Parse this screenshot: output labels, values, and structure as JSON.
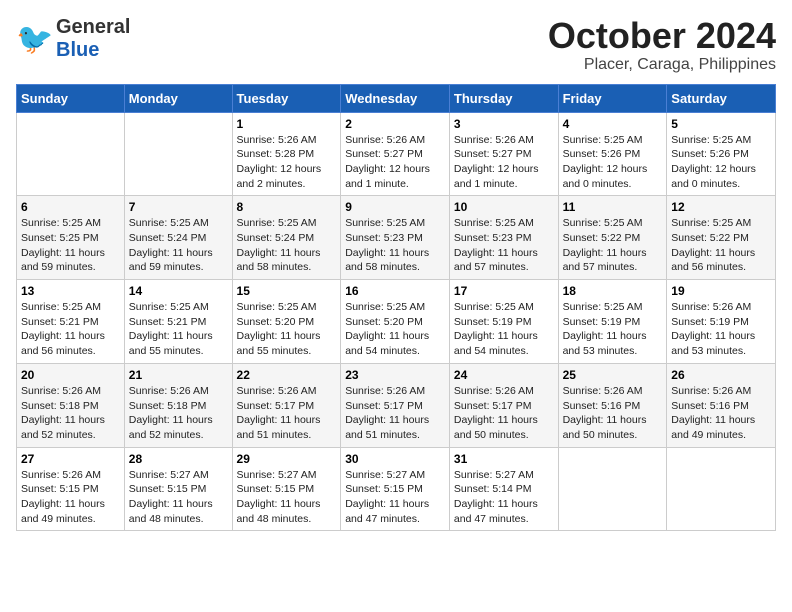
{
  "header": {
    "logo_line1": "General",
    "logo_line2": "Blue",
    "title": "October 2024",
    "subtitle": "Placer, Caraga, Philippines"
  },
  "calendar": {
    "days_of_week": [
      "Sunday",
      "Monday",
      "Tuesday",
      "Wednesday",
      "Thursday",
      "Friday",
      "Saturday"
    ],
    "weeks": [
      [
        {
          "day": "",
          "info": ""
        },
        {
          "day": "",
          "info": ""
        },
        {
          "day": "1",
          "info": "Sunrise: 5:26 AM\nSunset: 5:28 PM\nDaylight: 12 hours\nand 2 minutes."
        },
        {
          "day": "2",
          "info": "Sunrise: 5:26 AM\nSunset: 5:27 PM\nDaylight: 12 hours\nand 1 minute."
        },
        {
          "day": "3",
          "info": "Sunrise: 5:26 AM\nSunset: 5:27 PM\nDaylight: 12 hours\nand 1 minute."
        },
        {
          "day": "4",
          "info": "Sunrise: 5:25 AM\nSunset: 5:26 PM\nDaylight: 12 hours\nand 0 minutes."
        },
        {
          "day": "5",
          "info": "Sunrise: 5:25 AM\nSunset: 5:26 PM\nDaylight: 12 hours\nand 0 minutes."
        }
      ],
      [
        {
          "day": "6",
          "info": "Sunrise: 5:25 AM\nSunset: 5:25 PM\nDaylight: 11 hours\nand 59 minutes."
        },
        {
          "day": "7",
          "info": "Sunrise: 5:25 AM\nSunset: 5:24 PM\nDaylight: 11 hours\nand 59 minutes."
        },
        {
          "day": "8",
          "info": "Sunrise: 5:25 AM\nSunset: 5:24 PM\nDaylight: 11 hours\nand 58 minutes."
        },
        {
          "day": "9",
          "info": "Sunrise: 5:25 AM\nSunset: 5:23 PM\nDaylight: 11 hours\nand 58 minutes."
        },
        {
          "day": "10",
          "info": "Sunrise: 5:25 AM\nSunset: 5:23 PM\nDaylight: 11 hours\nand 57 minutes."
        },
        {
          "day": "11",
          "info": "Sunrise: 5:25 AM\nSunset: 5:22 PM\nDaylight: 11 hours\nand 57 minutes."
        },
        {
          "day": "12",
          "info": "Sunrise: 5:25 AM\nSunset: 5:22 PM\nDaylight: 11 hours\nand 56 minutes."
        }
      ],
      [
        {
          "day": "13",
          "info": "Sunrise: 5:25 AM\nSunset: 5:21 PM\nDaylight: 11 hours\nand 56 minutes."
        },
        {
          "day": "14",
          "info": "Sunrise: 5:25 AM\nSunset: 5:21 PM\nDaylight: 11 hours\nand 55 minutes."
        },
        {
          "day": "15",
          "info": "Sunrise: 5:25 AM\nSunset: 5:20 PM\nDaylight: 11 hours\nand 55 minutes."
        },
        {
          "day": "16",
          "info": "Sunrise: 5:25 AM\nSunset: 5:20 PM\nDaylight: 11 hours\nand 54 minutes."
        },
        {
          "day": "17",
          "info": "Sunrise: 5:25 AM\nSunset: 5:19 PM\nDaylight: 11 hours\nand 54 minutes."
        },
        {
          "day": "18",
          "info": "Sunrise: 5:25 AM\nSunset: 5:19 PM\nDaylight: 11 hours\nand 53 minutes."
        },
        {
          "day": "19",
          "info": "Sunrise: 5:26 AM\nSunset: 5:19 PM\nDaylight: 11 hours\nand 53 minutes."
        }
      ],
      [
        {
          "day": "20",
          "info": "Sunrise: 5:26 AM\nSunset: 5:18 PM\nDaylight: 11 hours\nand 52 minutes."
        },
        {
          "day": "21",
          "info": "Sunrise: 5:26 AM\nSunset: 5:18 PM\nDaylight: 11 hours\nand 52 minutes."
        },
        {
          "day": "22",
          "info": "Sunrise: 5:26 AM\nSunset: 5:17 PM\nDaylight: 11 hours\nand 51 minutes."
        },
        {
          "day": "23",
          "info": "Sunrise: 5:26 AM\nSunset: 5:17 PM\nDaylight: 11 hours\nand 51 minutes."
        },
        {
          "day": "24",
          "info": "Sunrise: 5:26 AM\nSunset: 5:17 PM\nDaylight: 11 hours\nand 50 minutes."
        },
        {
          "day": "25",
          "info": "Sunrise: 5:26 AM\nSunset: 5:16 PM\nDaylight: 11 hours\nand 50 minutes."
        },
        {
          "day": "26",
          "info": "Sunrise: 5:26 AM\nSunset: 5:16 PM\nDaylight: 11 hours\nand 49 minutes."
        }
      ],
      [
        {
          "day": "27",
          "info": "Sunrise: 5:26 AM\nSunset: 5:15 PM\nDaylight: 11 hours\nand 49 minutes."
        },
        {
          "day": "28",
          "info": "Sunrise: 5:27 AM\nSunset: 5:15 PM\nDaylight: 11 hours\nand 48 minutes."
        },
        {
          "day": "29",
          "info": "Sunrise: 5:27 AM\nSunset: 5:15 PM\nDaylight: 11 hours\nand 48 minutes."
        },
        {
          "day": "30",
          "info": "Sunrise: 5:27 AM\nSunset: 5:15 PM\nDaylight: 11 hours\nand 47 minutes."
        },
        {
          "day": "31",
          "info": "Sunrise: 5:27 AM\nSunset: 5:14 PM\nDaylight: 11 hours\nand 47 minutes."
        },
        {
          "day": "",
          "info": ""
        },
        {
          "day": "",
          "info": ""
        }
      ]
    ]
  }
}
